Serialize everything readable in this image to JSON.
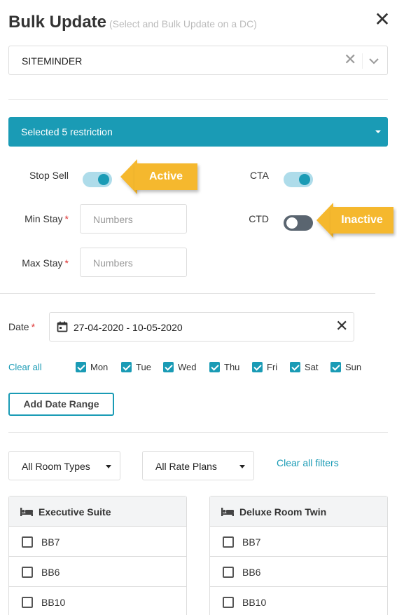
{
  "header": {
    "title": "Bulk Update",
    "subtitle": "(Select and Bulk Update on a DC)",
    "close_glyph": "✕"
  },
  "channel_select": {
    "value": "SITEMINDER",
    "clear_glyph": "✕"
  },
  "restriction_bar": {
    "label": "Selected 5 restriction"
  },
  "restrictions": {
    "stop_sell": {
      "label": "Stop Sell",
      "on": true
    },
    "cta": {
      "label": "CTA",
      "on": true
    },
    "ctd": {
      "label": "CTD",
      "on": false
    },
    "min_stay": {
      "label": "Min Stay",
      "required_mark": "*",
      "placeholder": "Numbers"
    },
    "max_stay": {
      "label": "Max Stay",
      "required_mark": "*",
      "placeholder": "Numbers"
    }
  },
  "callouts": {
    "active": "Active",
    "inactive": "Inactive",
    "color": "#f5b82e"
  },
  "date": {
    "label": "Date",
    "required_mark": "*",
    "value": "27-04-2020 - 10-05-2020",
    "clear_glyph": "✕"
  },
  "days": {
    "clear_all": "Clear all",
    "items": [
      {
        "label": "Mon",
        "checked": true
      },
      {
        "label": "Tue",
        "checked": true
      },
      {
        "label": "Wed",
        "checked": true
      },
      {
        "label": "Thu",
        "checked": true
      },
      {
        "label": "Fri",
        "checked": true
      },
      {
        "label": "Sat",
        "checked": true
      },
      {
        "label": "Sun",
        "checked": true
      }
    ]
  },
  "add_date_range": "Add Date Range",
  "filters": {
    "room_types": "All Room Types",
    "rate_plans": "All Rate Plans",
    "clear_all": "Clear all filters"
  },
  "rooms": [
    {
      "name": "Executive Suite",
      "rate_plans": [
        "BB7",
        "BB6",
        "BB10"
      ]
    },
    {
      "name": "Deluxe Room Twin",
      "rate_plans": [
        "BB7",
        "BB6",
        "BB10"
      ]
    }
  ],
  "colors": {
    "accent": "#1a9bb5",
    "required": "#d33333"
  }
}
